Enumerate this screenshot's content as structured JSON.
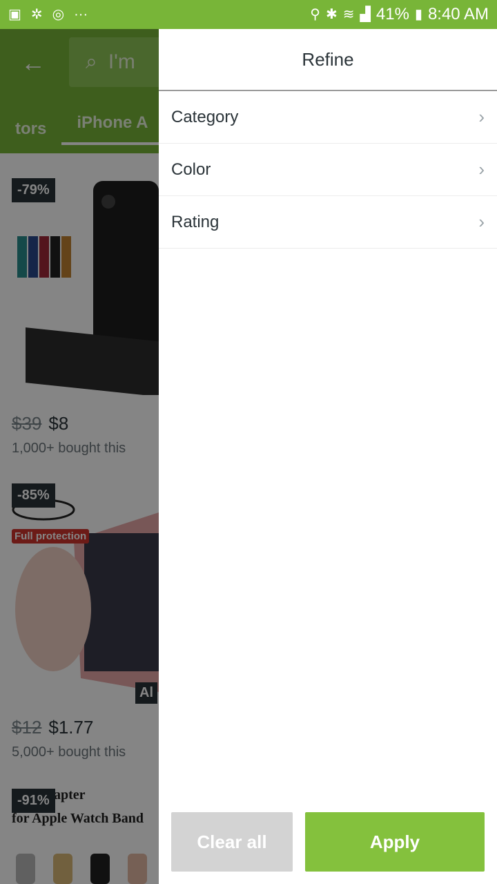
{
  "status_bar": {
    "battery": "41%",
    "time": "8:40 AM",
    "left_icons": [
      "gallery-icon",
      "share-icon",
      "sync-icon",
      "more-dots-icon"
    ],
    "right_icons": [
      "location-icon",
      "bluetooth-icon",
      "wifi-icon",
      "signal-icon",
      "battery-icon"
    ]
  },
  "background": {
    "search_placeholder": "I'm",
    "tabs": [
      "tors",
      "iPhone A"
    ],
    "products": [
      {
        "discount": "-79%",
        "old_price": "$39",
        "price": "$8",
        "bought": "1,000+ bought this"
      },
      {
        "discount": "-85%",
        "old_price": "$12",
        "price": "$1.77",
        "bought": "5,000+ bought this",
        "badge": "Full protection",
        "corner_label": "Al"
      },
      {
        "discount": "-91%",
        "caption_line1": "apter",
        "caption_line2": "for Apple Watch Band"
      }
    ]
  },
  "drawer": {
    "title": "Refine",
    "items": [
      "Category",
      "Color",
      "Rating"
    ],
    "clear_label": "Clear all",
    "apply_label": "Apply"
  },
  "colors": {
    "brand_green": "#78b538",
    "apply_green": "#84c13d",
    "clear_gray": "#d3d3d3"
  }
}
